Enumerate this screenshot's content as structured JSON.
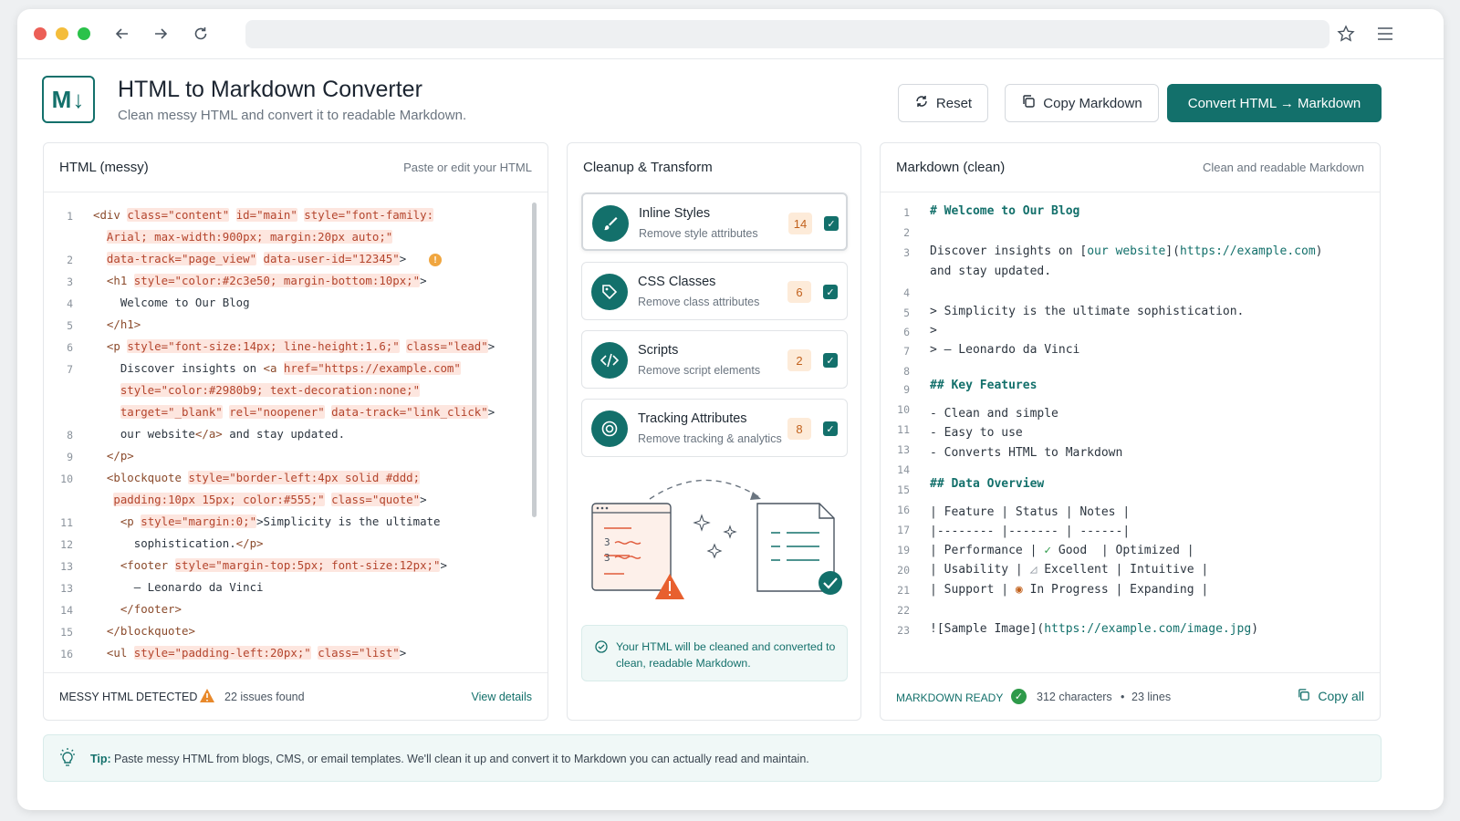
{
  "app": {
    "title": "HTML to Markdown Converter",
    "subtitle": "Clean messy HTML and convert it to readable Markdown.",
    "logo_text": "M↓"
  },
  "toolbar": {
    "reset_label": "Reset",
    "copy_markdown_label": "Copy Markdown",
    "convert_label": "Convert HTML → Markdown"
  },
  "html_panel": {
    "title": "HTML (messy)",
    "hint": "Paste or edit your HTML",
    "line_numbers": [
      "1",
      "2",
      "3",
      "4",
      "5",
      "6",
      "7",
      "8",
      "9",
      "10",
      "11",
      "12",
      "13",
      "13",
      "14",
      "15",
      "16"
    ],
    "footer_status": "MESSY HTML DETECTED",
    "footer_issues": "22 issues found",
    "footer_link": "View details"
  },
  "transform_panel": {
    "title": "Cleanup & Transform",
    "items": [
      {
        "title": "Inline Styles",
        "desc": "Remove style attributes",
        "count": "14",
        "icon": "brush-icon"
      },
      {
        "title": "CSS Classes",
        "desc": "Remove class attributes",
        "count": "6",
        "icon": "tag-icon"
      },
      {
        "title": "Scripts",
        "desc": "Remove script elements",
        "count": "2",
        "icon": "code-icon"
      },
      {
        "title": "Tracking Attributes",
        "desc": "Remove tracking & analytics",
        "count": "8",
        "icon": "target-icon"
      }
    ],
    "illustration_chars": [
      "3",
      "3"
    ],
    "note": "Your HTML will be cleaned and converted to clean, readable Markdown."
  },
  "md_panel": {
    "title": "Markdown (clean)",
    "hint": "Clean and readable Markdown",
    "line_numbers": [
      "1",
      "2",
      "3",
      "4",
      "5",
      "6",
      "7",
      "8",
      "9",
      "10",
      "11",
      "13",
      "14",
      "15",
      "16",
      "17",
      "19",
      "20",
      "21",
      "22",
      "23"
    ],
    "footer_status": "MARKDOWN READY",
    "footer_chars": "312 characters",
    "footer_sep": "•",
    "footer_lines": "23 lines",
    "copy_all_label": "Copy all"
  },
  "tip": {
    "label": "Tip:",
    "text": "Paste messy HTML from blogs, CMS, or email templates. We'll clean it up and convert it to Markdown you can actually read and maintain."
  },
  "colors": {
    "accent": "#13706b",
    "warning": "#e8892b",
    "attr_bg": "#fde6df"
  }
}
